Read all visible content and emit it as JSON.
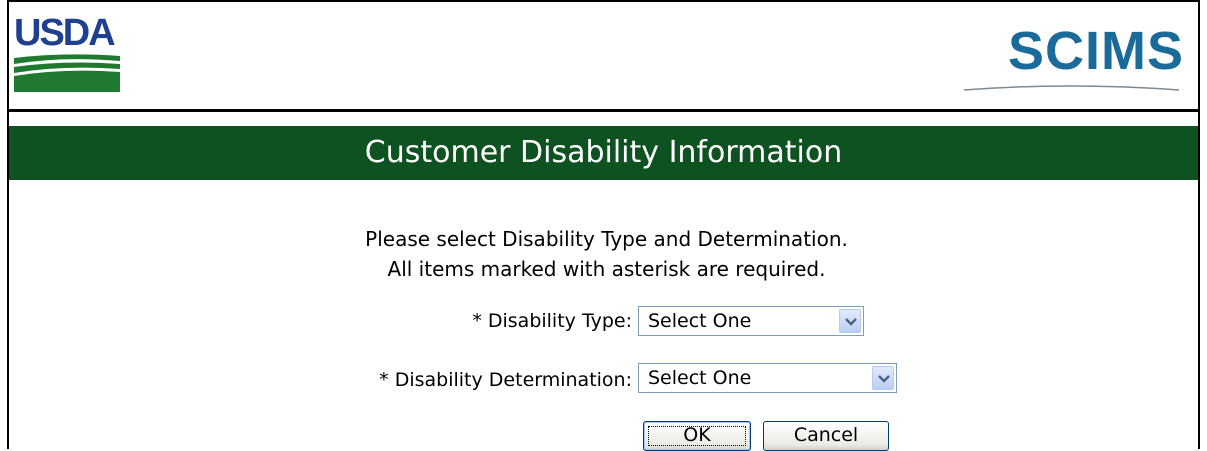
{
  "header": {
    "left_logo_text": "USDA",
    "right_logo_text": "SCIMS"
  },
  "title_bar": {
    "title": "Customer Disability Information"
  },
  "instructions": {
    "line1": "Please select Disability Type and Determination.",
    "line2": "All items marked with asterisk are required."
  },
  "form": {
    "disability_type": {
      "label": "* Disability Type:",
      "selected": "Select One"
    },
    "disability_determination": {
      "label": "* Disability Determination:",
      "selected": "Select One"
    }
  },
  "buttons": {
    "ok_label": "OK",
    "cancel_label": "Cancel"
  },
  "colors": {
    "title_bar_bg": "#0d5220",
    "usda_blue": "#1f3f8f",
    "scims_blue": "#1a6a9a"
  }
}
